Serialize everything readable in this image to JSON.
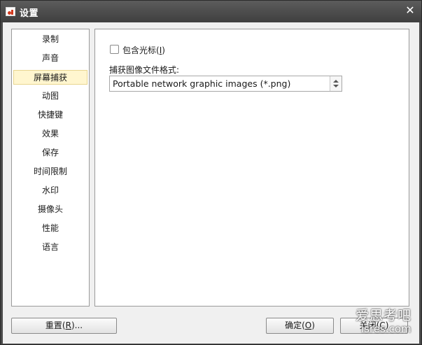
{
  "window": {
    "title": "设置",
    "close_label": "✕"
  },
  "sidebar": {
    "selected_index": 2,
    "items": [
      {
        "label": "录制"
      },
      {
        "label": "声音"
      },
      {
        "label": "屏幕捕获"
      },
      {
        "label": "动图"
      },
      {
        "label": "快捷键"
      },
      {
        "label": "效果"
      },
      {
        "label": "保存"
      },
      {
        "label": "时间限制"
      },
      {
        "label": "水印"
      },
      {
        "label": "摄像头"
      },
      {
        "label": "性能"
      },
      {
        "label": "语言"
      }
    ]
  },
  "main": {
    "include_cursor": {
      "label_prefix": "包含光标(",
      "mnemonic": "I",
      "label_suffix": ")",
      "checked": false
    },
    "image_format": {
      "label": "捕获图像文件格式:",
      "selected": "Portable network graphic images (*.png)"
    }
  },
  "footer": {
    "reset": {
      "prefix": "重置(",
      "mnemonic": "R",
      "suffix": ")..."
    },
    "ok": {
      "prefix": "确定(",
      "mnemonic": "O",
      "suffix": ")"
    },
    "cancel": {
      "prefix": "关闭(",
      "mnemonic": "C",
      "suffix": ")"
    }
  },
  "watermark": {
    "cn": "爱思考吧",
    "en": "isres.com"
  },
  "icons": {
    "app": "app-icon",
    "close": "close-icon",
    "spin": "spin-arrows-icon"
  },
  "colors": {
    "titlebar": "#4a4a4a",
    "selected_item_bg": "#fff6cf",
    "client_bg": "#f0f0f0"
  }
}
